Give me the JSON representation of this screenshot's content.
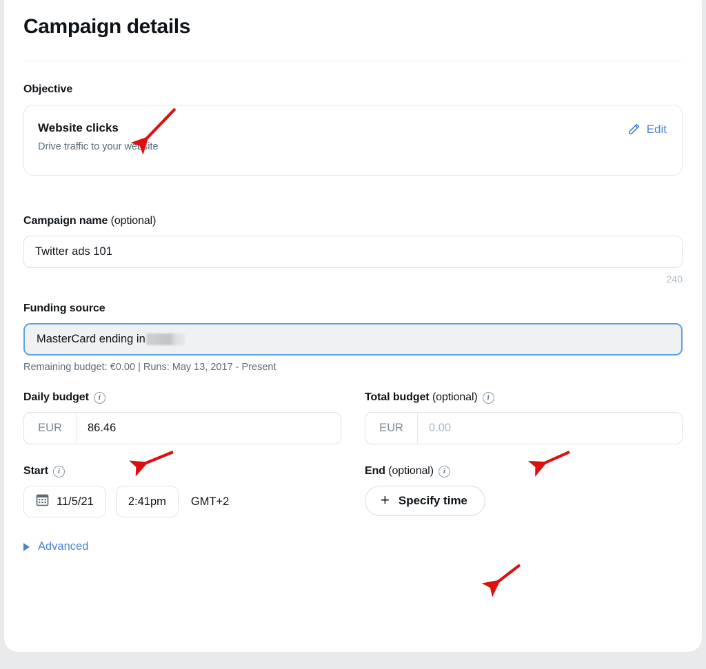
{
  "page": {
    "title": "Campaign details"
  },
  "objective": {
    "label": "Objective",
    "name": "Website clicks",
    "description": "Drive traffic to your website",
    "edit_label": "Edit",
    "edit_icon": "pencil-icon"
  },
  "campaign_name": {
    "label": "Campaign name",
    "optional": " (optional)",
    "value": "Twitter ads 101",
    "char_count": "240"
  },
  "funding_source": {
    "label": "Funding source",
    "value": "MasterCard ending in",
    "redacted": true,
    "note": "Remaining budget: €0.00 | Runs: May 13, 2017 - Present"
  },
  "daily_budget": {
    "label": "Daily budget",
    "info_icon": "info-icon",
    "currency": "EUR",
    "value": "86.46"
  },
  "total_budget": {
    "label": "Total budget",
    "optional": " (optional)",
    "info_icon": "info-icon",
    "currency": "EUR",
    "placeholder": "0.00"
  },
  "start": {
    "label": "Start",
    "info_icon": "info-icon",
    "date_icon": "calendar-icon",
    "date": "11/5/21",
    "time": "2:41pm",
    "timezone": "GMT+2"
  },
  "end": {
    "label": "End",
    "optional": " (optional)",
    "info_icon": "info-icon",
    "specify_label": "Specify time",
    "plus_icon": "plus-icon"
  },
  "advanced": {
    "label": "Advanced",
    "icon": "triangle-right-icon"
  },
  "colors": {
    "link": "#4a83d4",
    "focus_border": "#5aa2e8",
    "annotation": "#dd1010",
    "text": "#0f1419",
    "muted": "#5c6b77"
  },
  "annotations": [
    {
      "name": "arrow-to-objective"
    },
    {
      "name": "arrow-to-daily-budget"
    },
    {
      "name": "arrow-to-total-budget"
    },
    {
      "name": "arrow-to-specify-time"
    }
  ]
}
